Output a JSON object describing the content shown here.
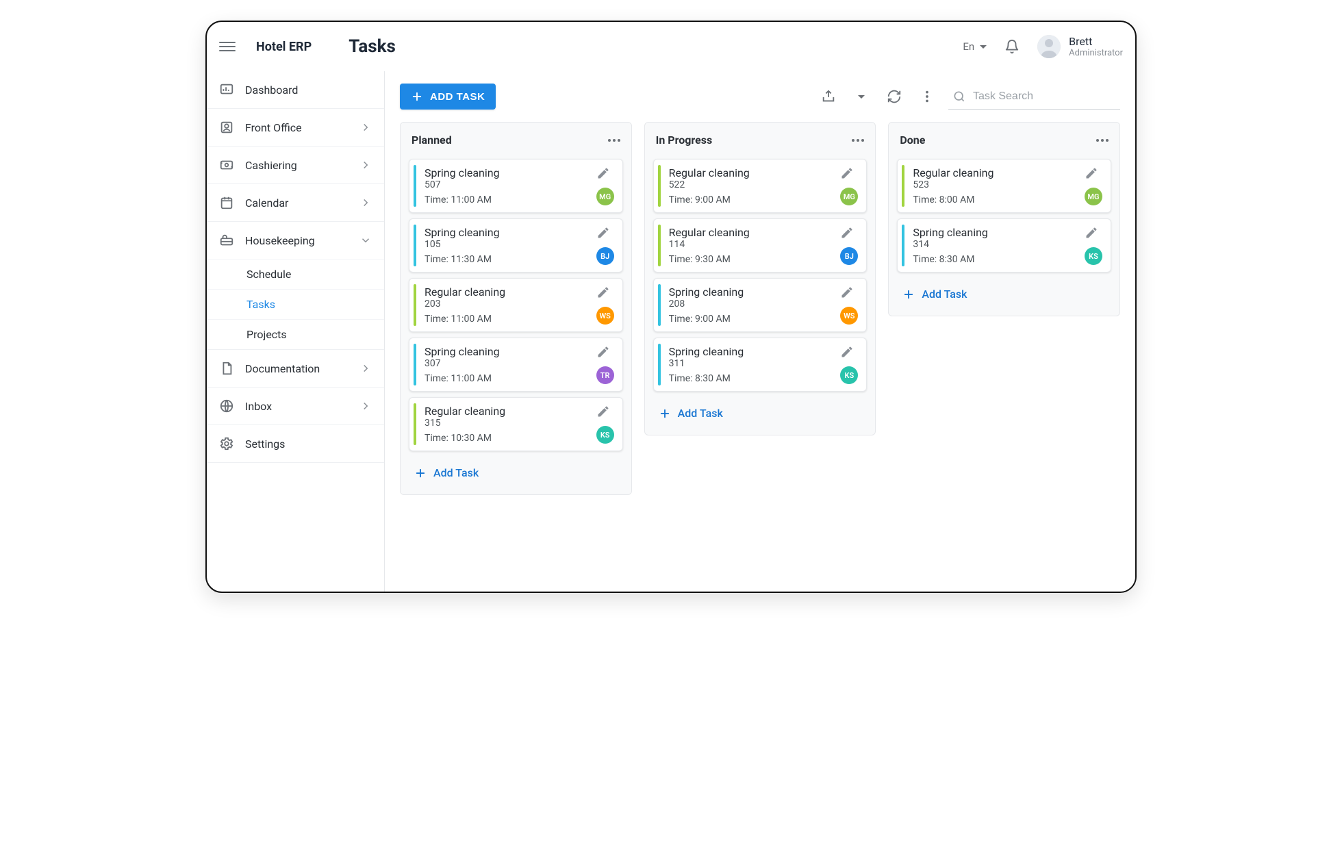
{
  "app": {
    "brand": "Hotel ERP",
    "page_title": "Tasks",
    "language": "En",
    "user": {
      "name": "Brett",
      "role": "Administrator"
    },
    "search_placeholder": "Task Search"
  },
  "sidebar": {
    "items": [
      {
        "id": "dashboard",
        "label": "Dashboard"
      },
      {
        "id": "front_office",
        "label": "Front Office"
      },
      {
        "id": "cashiering",
        "label": "Cashiering"
      },
      {
        "id": "calendar",
        "label": "Calendar"
      },
      {
        "id": "housekeeping",
        "label": "Housekeeping",
        "expanded": true,
        "children": [
          {
            "id": "hk_schedule",
            "label": "Schedule"
          },
          {
            "id": "hk_tasks",
            "label": "Tasks"
          },
          {
            "id": "hk_projects",
            "label": "Projects"
          }
        ],
        "active_child": "hk_tasks"
      },
      {
        "id": "documentation",
        "label": "Documentation"
      },
      {
        "id": "inbox",
        "label": "Inbox"
      },
      {
        "id": "settings",
        "label": "Settings"
      }
    ]
  },
  "toolbar": {
    "add_task_label": "ADD TASK"
  },
  "board": {
    "columns": [
      {
        "id": "planned",
        "title": "Planned",
        "add_label": "Add Task",
        "cards": [
          {
            "title": "Spring cleaning",
            "room": "507",
            "time_label": "Time: 11:00 AM",
            "stripe": "cyan",
            "assignee": {
              "initials": "MG",
              "color": "green"
            }
          },
          {
            "title": "Spring cleaning",
            "room": "105",
            "time_label": "Time: 11:30 AM",
            "stripe": "cyan",
            "assignee": {
              "initials": "BJ",
              "color": "blue"
            }
          },
          {
            "title": "Regular cleaning",
            "room": "203",
            "time_label": "Time: 11:00 AM",
            "stripe": "lime",
            "assignee": {
              "initials": "WS",
              "color": "orange"
            }
          },
          {
            "title": "Spring cleaning",
            "room": "307",
            "time_label": "Time: 11:00 AM",
            "stripe": "cyan",
            "assignee": {
              "initials": "TR",
              "color": "purple"
            }
          },
          {
            "title": "Regular cleaning",
            "room": "315",
            "time_label": "Time: 10:30 AM",
            "stripe": "lime",
            "assignee": {
              "initials": "KS",
              "color": "teal"
            }
          }
        ]
      },
      {
        "id": "in_progress",
        "title": "In Progress",
        "add_label": "Add Task",
        "cards": [
          {
            "title": "Regular cleaning",
            "room": "522",
            "time_label": "Time: 9:00 AM",
            "stripe": "lime",
            "assignee": {
              "initials": "MG",
              "color": "green"
            }
          },
          {
            "title": "Regular cleaning",
            "room": "114",
            "time_label": "Time: 9:30 AM",
            "stripe": "lime",
            "assignee": {
              "initials": "BJ",
              "color": "blue"
            }
          },
          {
            "title": "Spring cleaning",
            "room": "208",
            "time_label": "Time: 9:00 AM",
            "stripe": "cyan",
            "assignee": {
              "initials": "WS",
              "color": "orange"
            }
          },
          {
            "title": "Spring cleaning",
            "room": "311",
            "time_label": "Time: 8:30 AM",
            "stripe": "cyan",
            "assignee": {
              "initials": "KS",
              "color": "teal"
            }
          }
        ]
      },
      {
        "id": "done",
        "title": "Done",
        "add_label": "Add Task",
        "cards": [
          {
            "title": "Regular cleaning",
            "room": "523",
            "time_label": "Time: 8:00 AM",
            "stripe": "lime",
            "assignee": {
              "initials": "MG",
              "color": "green"
            }
          },
          {
            "title": "Spring cleaning",
            "room": "314",
            "time_label": "Time: 8:30 AM",
            "stripe": "cyan",
            "assignee": {
              "initials": "KS",
              "color": "teal"
            }
          }
        ]
      }
    ]
  }
}
